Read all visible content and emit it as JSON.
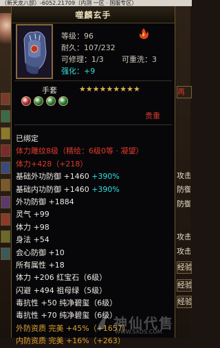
{
  "window_title": "（新天龙八部）-6052.21709（内测 一区 · 国服专区）",
  "left_strip": {
    "skills": 10
  },
  "right_strip": {
    "tabs": [
      {
        "label": "再",
        "style": "red boxed"
      },
      {
        "label": "攻击",
        "style": ""
      },
      {
        "label": "防御",
        "style": ""
      },
      {
        "label": "防御",
        "style": ""
      },
      {
        "label": "攻击",
        "style": ""
      },
      {
        "label": "攻击",
        "style": ""
      },
      {
        "label": "经验",
        "style": "boxed"
      },
      {
        "label": "经验",
        "style": "boxed"
      },
      {
        "label": "经验",
        "style": "boxed"
      }
    ]
  },
  "item": {
    "name": "噬麟玄手",
    "level": "等级：96",
    "durability": "耐久：107/232",
    "repairable": "可修理：1/3",
    "rewashable": "可重洗：3",
    "enhance": "强化：+9",
    "slot": "手套",
    "stars_total": 9,
    "stars_on": 9,
    "gems": [
      {
        "color": "#c0303a"
      },
      {
        "color": "#2e8a3a"
      },
      {
        "color": "#2e8a3a"
      },
      {
        "color": "#2e8a3a"
      }
    ],
    "price_label": "贵重",
    "lines": [
      {
        "segs": [
          {
            "t": "已绑定",
            "c": "c-white"
          }
        ]
      },
      {
        "segs": [
          {
            "t": "体力雕纹8级（精绘：6级0等 · 凝望）",
            "c": "c-red"
          }
        ]
      },
      {
        "segs": [
          {
            "t": "体力+428（+218）",
            "c": "c-red"
          }
        ]
      },
      {
        "segs": [
          {
            "t": "基础外功防御 +1460 ",
            "c": "c-white"
          },
          {
            "t": "+390%",
            "c": "c-cyan"
          }
        ]
      },
      {
        "segs": [
          {
            "t": "基础内功防御 +1460 ",
            "c": "c-white"
          },
          {
            "t": "+390%",
            "c": "c-cyan"
          }
        ]
      },
      {
        "segs": [
          {
            "t": "外功防御 +1884",
            "c": "c-white"
          }
        ]
      },
      {
        "segs": [
          {
            "t": "灵气 +99",
            "c": "c-white"
          }
        ]
      },
      {
        "segs": [
          {
            "t": "体力 +98",
            "c": "c-white"
          }
        ]
      },
      {
        "segs": [
          {
            "t": "身法 +54",
            "c": "c-white"
          }
        ]
      },
      {
        "segs": [
          {
            "t": "会心防御 +10",
            "c": "c-white"
          }
        ]
      },
      {
        "segs": [
          {
            "t": "所有属性 +18",
            "c": "c-white"
          }
        ]
      },
      {
        "segs": [
          {
            "t": "体力 +206 红宝石（6级）",
            "c": "c-white"
          }
        ]
      },
      {
        "segs": [
          {
            "t": "闪避 +494 祖母绿（5级）",
            "c": "c-white"
          }
        ]
      },
      {
        "segs": [
          {
            "t": "毒抗性 +50 纯净碧玺（6级）",
            "c": "c-white"
          }
        ]
      },
      {
        "segs": [
          {
            "t": "毒抗性 +70 纯净碧玺（6级）",
            "c": "c-white"
          }
        ]
      },
      {
        "segs": [
          {
            "t": "外防资质 ",
            "c": "c-gold"
          },
          {
            "t": "完美 +45%（+1657）",
            "c": "c-gold"
          }
        ]
      },
      {
        "segs": [
          {
            "t": "内防资质 ",
            "c": "c-gold"
          },
          {
            "t": "完美 +16%（+263）",
            "c": "c-gold"
          }
        ]
      }
    ]
  },
  "watermark": {
    "text": "神仙代售",
    "url": "WWW.SXDS.COM"
  }
}
